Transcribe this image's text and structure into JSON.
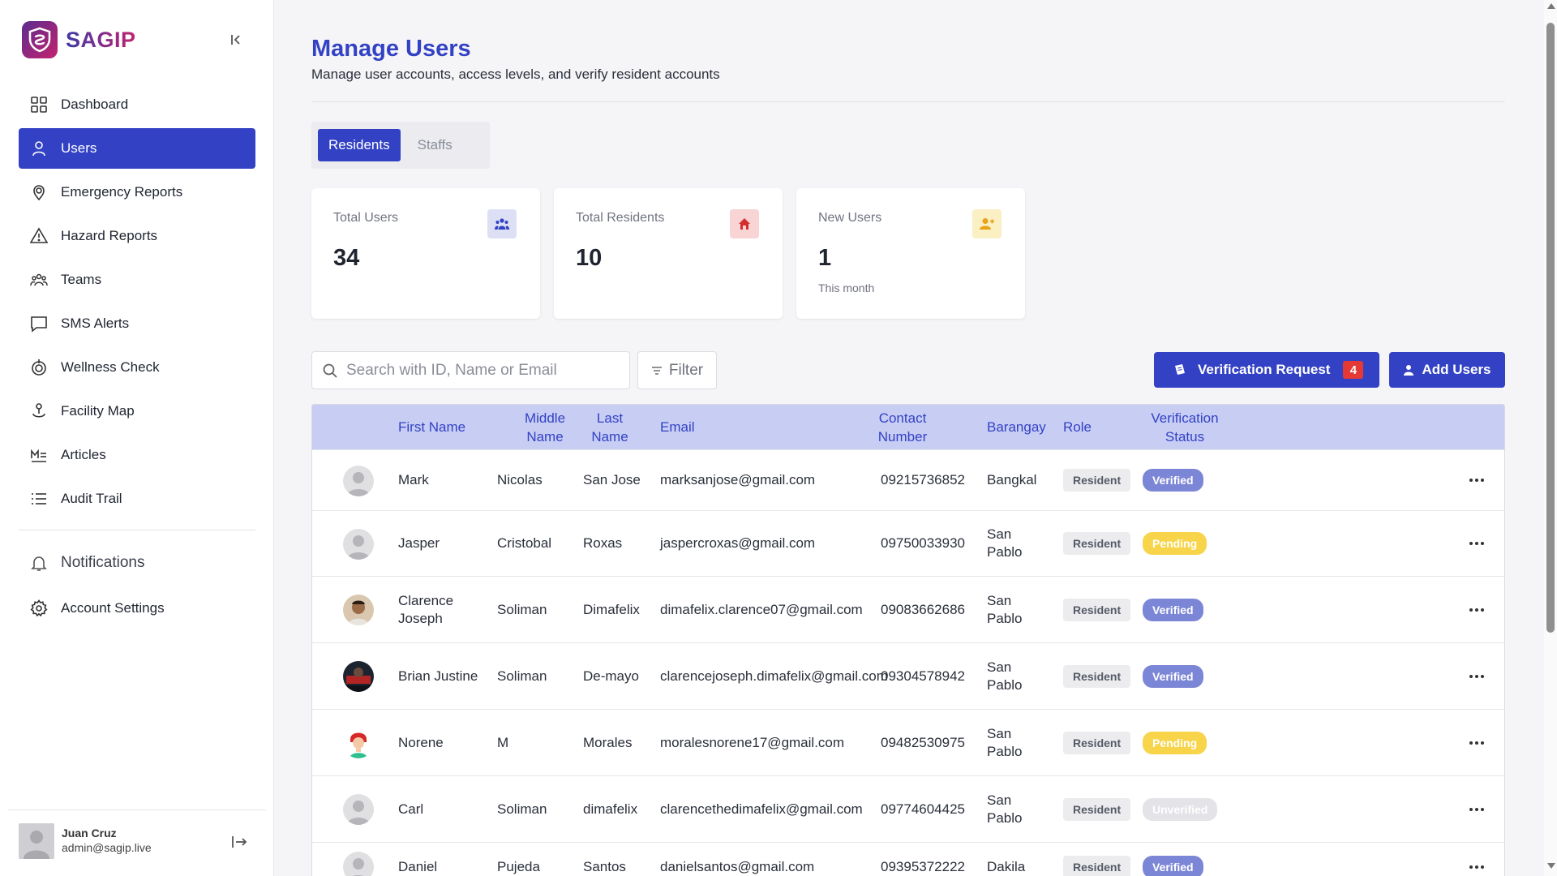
{
  "brand": {
    "name": "SAGIP"
  },
  "sidebar": {
    "items": [
      {
        "label": "Dashboard",
        "icon": "grid-icon"
      },
      {
        "label": "Users",
        "icon": "user-icon",
        "active": true
      },
      {
        "label": "Emergency Reports",
        "icon": "location-pin-icon"
      },
      {
        "label": "Hazard Reports",
        "icon": "warning-icon"
      },
      {
        "label": "Teams",
        "icon": "teams-icon"
      },
      {
        "label": "SMS Alerts",
        "icon": "message-icon"
      },
      {
        "label": "Wellness Check",
        "icon": "wellness-icon"
      },
      {
        "label": "Facility Map",
        "icon": "map-person-icon"
      },
      {
        "label": "Articles",
        "icon": "articles-icon"
      },
      {
        "label": "Audit Trail",
        "icon": "list-icon"
      }
    ],
    "notifications_label": "Notifications",
    "account_settings_label": "Account Settings"
  },
  "user": {
    "name": "Juan Cruz",
    "email": "admin@sagip.live"
  },
  "page": {
    "title": "Manage Users",
    "subtitle": "Manage user accounts, access levels, and verify resident accounts"
  },
  "tabs": [
    {
      "label": "Residents",
      "active": true
    },
    {
      "label": "Staffs",
      "active": false
    }
  ],
  "stats": [
    {
      "label": "Total Users",
      "value": "34",
      "note": "",
      "icon": "group-icon",
      "bg": "#dde0f5",
      "fg": "#3342c4"
    },
    {
      "label": "Total Residents",
      "value": "10",
      "note": "",
      "icon": "home-icon",
      "bg": "#f8d4d4",
      "fg": "#d32f2f"
    },
    {
      "label": "New Users",
      "value": "1",
      "note": "This month",
      "icon": "user-add-icon",
      "bg": "#fbefc4",
      "fg": "#e8a317"
    }
  ],
  "search": {
    "placeholder": "Search with ID, Name or Email"
  },
  "filter_label": "Filter",
  "verification_request": {
    "label": "Verification Request",
    "count": "4"
  },
  "add_users_label": "Add Users",
  "table": {
    "headers": {
      "first_name": "First Name",
      "middle_name_1": "Middle",
      "middle_name_2": "Name",
      "last_name_1": "Last",
      "last_name_2": "Name",
      "email": "Email",
      "contact_1": "Contact",
      "contact_2": "Number",
      "barangay": "Barangay",
      "role": "Role",
      "verification_1": "Verification",
      "verification_2": "Status"
    },
    "rows": [
      {
        "first_1": "Mark",
        "first_2": "",
        "middle": "Nicolas",
        "last": "San Jose",
        "email": "marksanjose@gmail.com",
        "contact": "09215736852",
        "brgy_1": "Bangkal",
        "brgy_2": "",
        "role": "Resident",
        "status": "Verified",
        "status_kind": "verified",
        "avatar": "placeholder"
      },
      {
        "first_1": "Jasper",
        "first_2": "",
        "middle": "Cristobal",
        "last": "Roxas",
        "email": "jaspercroxas@gmail.com",
        "contact": "09750033930",
        "brgy_1": "San",
        "brgy_2": "Pablo",
        "role": "Resident",
        "status": "Pending",
        "status_kind": "pending",
        "avatar": "placeholder"
      },
      {
        "first_1": "Clarence",
        "first_2": "Joseph",
        "middle": "Soliman",
        "last": "Dimafelix",
        "email": "dimafelix.clarence07@gmail.com",
        "contact": "09083662686",
        "brgy_1": "San",
        "brgy_2": "Pablo",
        "role": "Resident",
        "status": "Verified",
        "status_kind": "verified",
        "avatar": "photo1"
      },
      {
        "first_1": "Brian Justine",
        "first_2": "",
        "middle": "Soliman",
        "last": "De-mayo",
        "email": "clarencejoseph.dimafelix@gmail.com",
        "contact": "09304578942",
        "brgy_1": "San",
        "brgy_2": "Pablo",
        "role": "Resident",
        "status": "Verified",
        "status_kind": "verified",
        "avatar": "photo2"
      },
      {
        "first_1": "Norene",
        "first_2": "",
        "middle": "M",
        "last": "Morales",
        "email": "moralesnorene17@gmail.com",
        "contact": "09482530975",
        "brgy_1": "San",
        "brgy_2": "Pablo",
        "role": "Resident",
        "status": "Pending",
        "status_kind": "pending",
        "avatar": "cartoon"
      },
      {
        "first_1": "Carl",
        "first_2": "",
        "middle": "Soliman",
        "last": "dimafelix",
        "email": "clarencethedimafelix@gmail.com",
        "contact": "09774604425",
        "brgy_1": "San",
        "brgy_2": "Pablo",
        "role": "Resident",
        "status": "Unverified",
        "status_kind": "unverified",
        "avatar": "placeholder"
      },
      {
        "first_1": "Daniel",
        "first_2": "",
        "middle": "Pujeda",
        "last": "Santos",
        "email": "danielsantos@gmail.com",
        "contact": "09395372222",
        "brgy_1": "Dakila",
        "brgy_2": "",
        "role": "Resident",
        "status": "Verified",
        "status_kind": "verified",
        "avatar": "placeholder"
      }
    ]
  },
  "colors": {
    "primary": "#3342c4",
    "header_bg": "#c8cdf4",
    "verified": "#7c86d6",
    "pending": "#f7d44a",
    "unverified": "#e3e3e8",
    "badge": "#e53935"
  }
}
